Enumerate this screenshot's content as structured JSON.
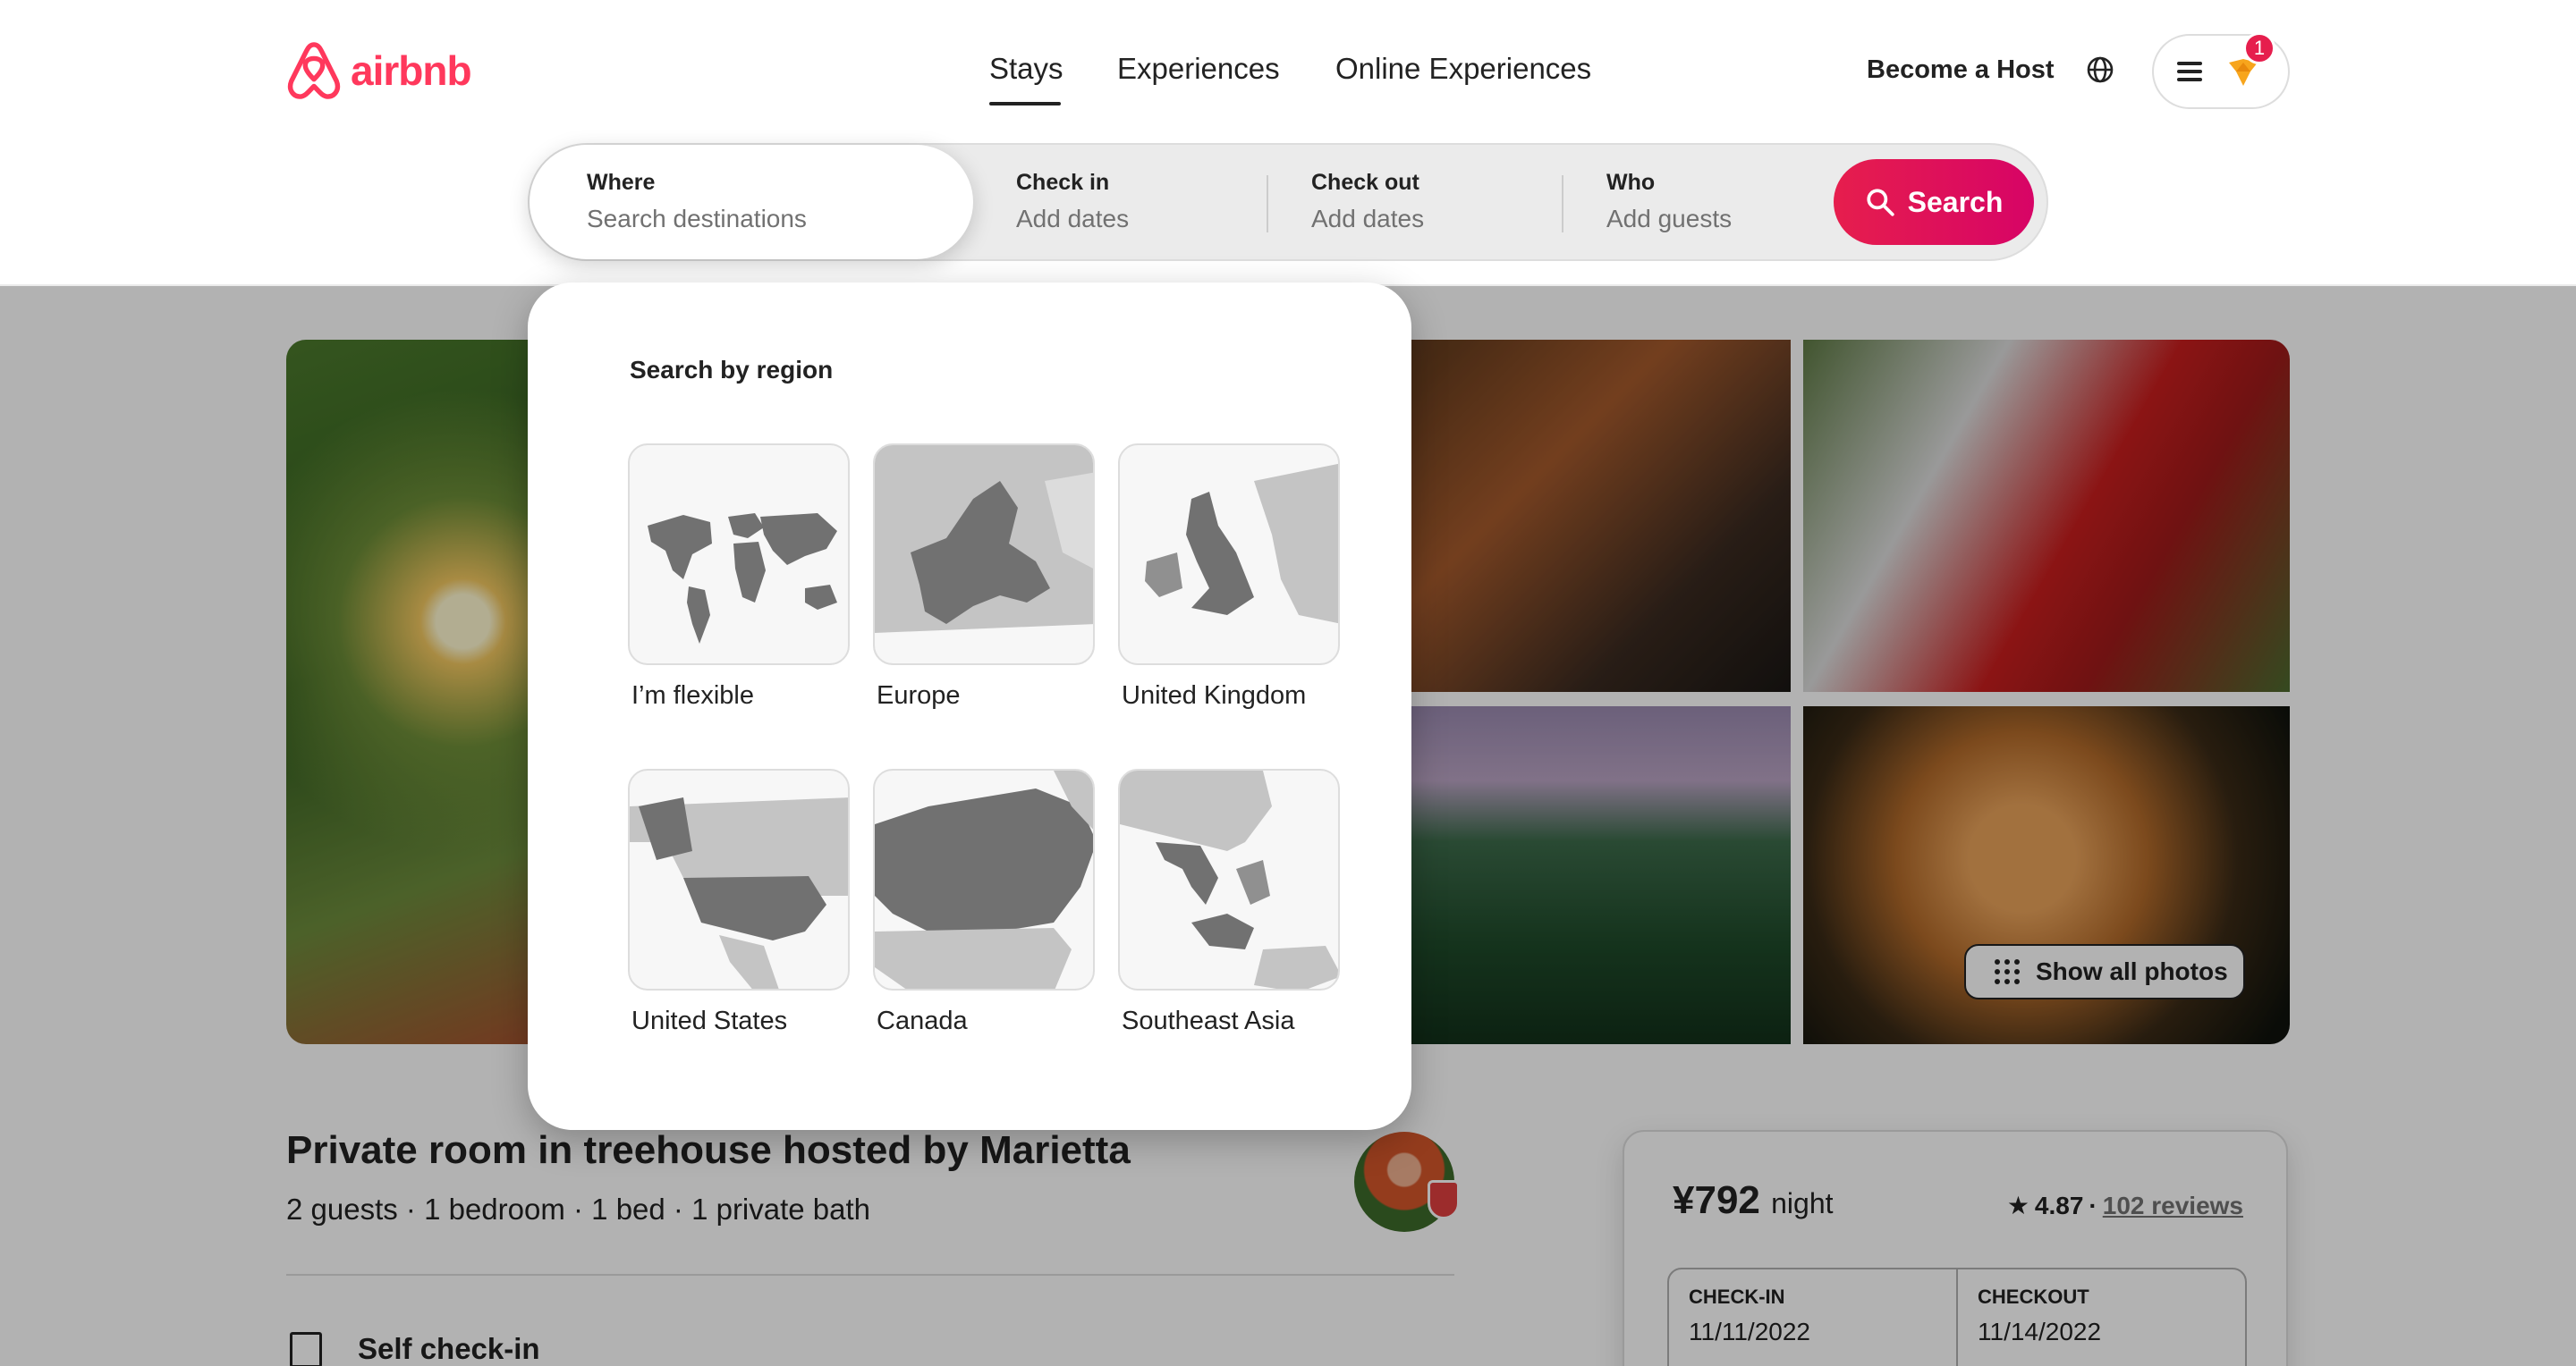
{
  "brand": {
    "name": "airbnb",
    "color": "#ff385c"
  },
  "nav": {
    "stays": "Stays",
    "experiences": "Experiences",
    "online_experiences": "Online Experiences"
  },
  "header_right": {
    "become_host": "Become a Host",
    "notification_count": "1",
    "globe_icon": "globe-icon",
    "menu_icon": "hamburger-icon"
  },
  "search": {
    "where_label": "Where",
    "where_placeholder": "Search destinations",
    "checkin_label": "Check in",
    "checkin_value": "Add dates",
    "checkout_label": "Check out",
    "checkout_value": "Add dates",
    "who_label": "Who",
    "who_value": "Add guests",
    "button_label": "Search",
    "accent": "#e61e4d"
  },
  "region_panel": {
    "title": "Search by region",
    "regions": [
      {
        "name": "I’m flexible"
      },
      {
        "name": "Europe"
      },
      {
        "name": "United Kingdom"
      },
      {
        "name": "United States"
      },
      {
        "name": "Canada"
      },
      {
        "name": "Southeast Asia"
      }
    ]
  },
  "gallery": {
    "show_all_label": "Show all photos"
  },
  "listing": {
    "title": "Private room in treehouse hosted by Marietta",
    "details": "2 guests · 1 bedroom · 1 bed · 1 private bath",
    "feature": "Self check-in"
  },
  "booking": {
    "price": "¥792",
    "price_unit": "night",
    "rating": "4.87",
    "separator": "·",
    "reviews": "102 reviews",
    "checkin_label": "CHECK-IN",
    "checkin_value": "11/11/2022",
    "checkout_label": "CHECKOUT",
    "checkout_value": "11/14/2022"
  }
}
